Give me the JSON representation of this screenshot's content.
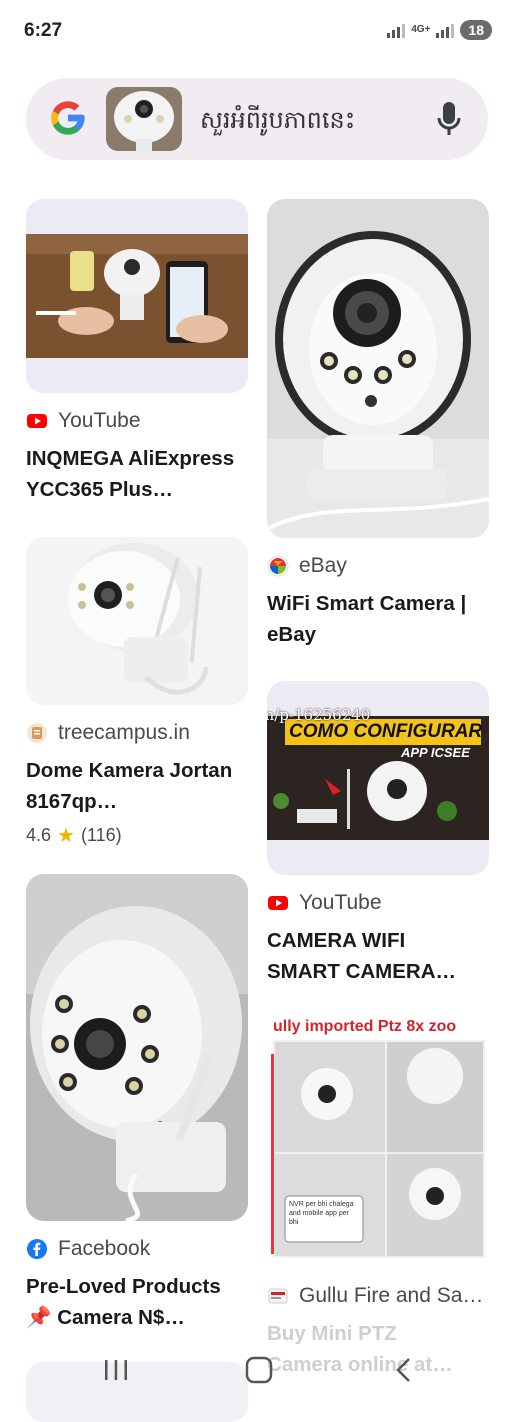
{
  "status_bar": {
    "time": "6:27",
    "network": "4G+",
    "battery": "18"
  },
  "search": {
    "query_text": "សួរអំពីរូបភាពនេះ"
  },
  "results": [
    {
      "source": "YouTube",
      "title_line1": "INQMEGA AliExpress",
      "title_line2": "YCC365 Plus…"
    },
    {
      "source": "eBay",
      "title_line1": "WiFi Smart Camera |",
      "title_line2": "eBay"
    },
    {
      "source": "treecampus.in",
      "title_line1": "Dome Kamera Jortan",
      "title_line2": "8167qp…",
      "rating": "4.6",
      "review_count": "(116)"
    },
    {
      "source": "YouTube",
      "title_line1": "CAMERA WIFI",
      "title_line2": "SMART CAMERA…",
      "overlay_url": "om/p-16256240",
      "overlay_heading": "COMO CONFIGURAR",
      "overlay_sub": "APP ICSEE"
    },
    {
      "source": "Facebook",
      "title_line1": "Pre-Loved Products",
      "title_line2": "📌 Camera N$…"
    },
    {
      "source": "Gullu Fire and Sa…",
      "title_line1": "Buy Mini PTZ",
      "title_line2": "Camera online at…",
      "overlay_heading": "ully imported Ptz 8x zoo",
      "overlay_note": "NVR per bhi chalega and mobile app per bhi"
    }
  ],
  "colors": {
    "youtube": "#ff0000",
    "facebook": "#1877f2",
    "search_bg": "#f1ecf1",
    "card_bg": "#eceaf2",
    "star": "#f2b400"
  }
}
